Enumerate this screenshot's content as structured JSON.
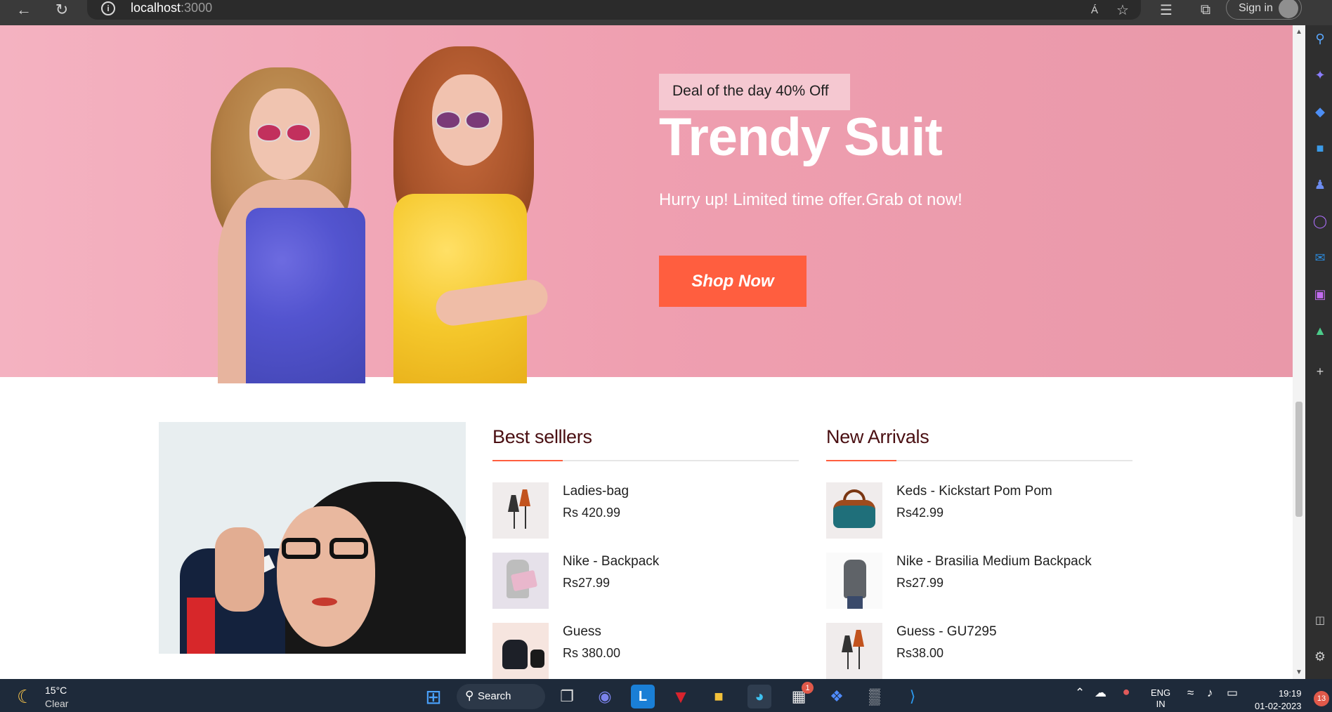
{
  "browser": {
    "url_host": "localhost",
    "url_port": ":3000",
    "sign_in_label": "Sign in",
    "read_aloud_label": "Á",
    "icons": [
      "back-icon",
      "refresh-icon",
      "info-icon",
      "read-aloud-icon",
      "add-favorite-icon",
      "favorites-icon",
      "collections-icon",
      "profile-avatar-icon"
    ]
  },
  "hero": {
    "badge": "Deal of the day 40% Off",
    "title": "Trendy Suit",
    "subtitle": "Hurry up! Limited time offer.Grab ot now!",
    "button": "Shop Now",
    "bg_color": "#ef9fb0",
    "button_color": "#ff5e3f"
  },
  "best_sellers": {
    "title": "Best selllers",
    "items": [
      {
        "name": "Ladies-bag",
        "price": "Rs 420.99"
      },
      {
        "name": "Nike - Backpack",
        "price": "Rs27.99"
      },
      {
        "name": "Guess",
        "price": "Rs 380.00"
      }
    ]
  },
  "new_arrivals": {
    "title": "New Arrivals",
    "items": [
      {
        "name": "Keds - Kickstart Pom Pom",
        "price": "Rs42.99"
      },
      {
        "name": "Nike - Brasilia Medium Backpack",
        "price": "Rs27.99"
      },
      {
        "name": "Guess - GU7295",
        "price": "Rs38.00"
      }
    ]
  },
  "edge_sidebar": {
    "icons": [
      "search-icon",
      "copilot-icon",
      "shopping-icon",
      "tools-icon",
      "games-icon",
      "office-icon",
      "outlook-icon",
      "designer-icon",
      "tree-icon",
      "add-icon",
      "split-screen-icon",
      "settings-icon"
    ]
  },
  "taskbar": {
    "temperature": "15°C",
    "condition": "Clear",
    "search_label": "Search",
    "store_badge": "1",
    "language_line1": "ENG",
    "language_line2": "IN",
    "time": "19:19",
    "date": "01-02-2023",
    "notification_count": "13"
  }
}
